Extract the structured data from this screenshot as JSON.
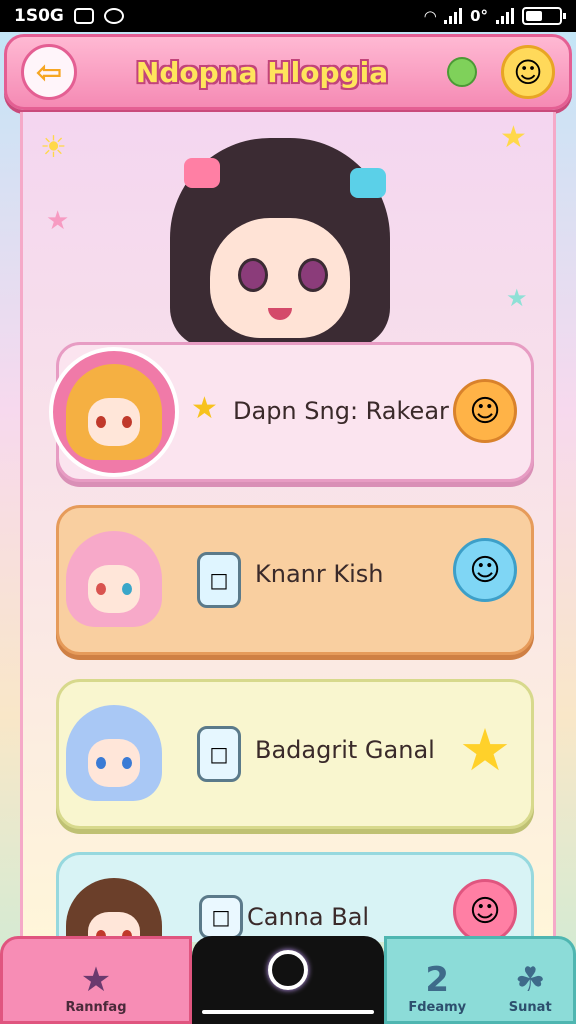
{
  "status_bar": {
    "time": "1S0G",
    "network": "0°"
  },
  "header": {
    "title": "Ndopna Hlopgia",
    "back_icon": "back-arrow-icon",
    "apple_icon": "green-apple-icon",
    "menu_icon": "smiley-face-icon"
  },
  "hero": {
    "character": "dark-haired-cat-ear-girl"
  },
  "cards": [
    {
      "label": "Dapn Sng: Rakear",
      "left_icon": "star-icon",
      "right_icon": "smiley-cookie-icon",
      "avatar": "orange-hair-girl",
      "color": "#fbe4ef"
    },
    {
      "label": "Knanr Kish",
      "left_icon": "bottle-icon",
      "right_icon": "lollipop-face-icon",
      "avatar": "pink-hair-cat-girl",
      "color": "#f9cfa0"
    },
    {
      "label": "Badagrit Ganal",
      "left_icon": "bottle-icon",
      "right_icon": "star-icon",
      "avatar": "blue-hair-cat-girl",
      "color": "#f9f6cf"
    },
    {
      "label": "Canna Bal",
      "left_icon": "bottle-icon",
      "right_icon": "pink-smiley-icon",
      "avatar": "brown-hair-cat-girl",
      "color": "#d8f3f5"
    }
  ],
  "bottom_nav": {
    "left_label": "Rannfag",
    "center_icon": "home-circle-icon",
    "mid_label": "Fdeamy",
    "right_label": "Sunat",
    "mid_glyph": "2"
  }
}
